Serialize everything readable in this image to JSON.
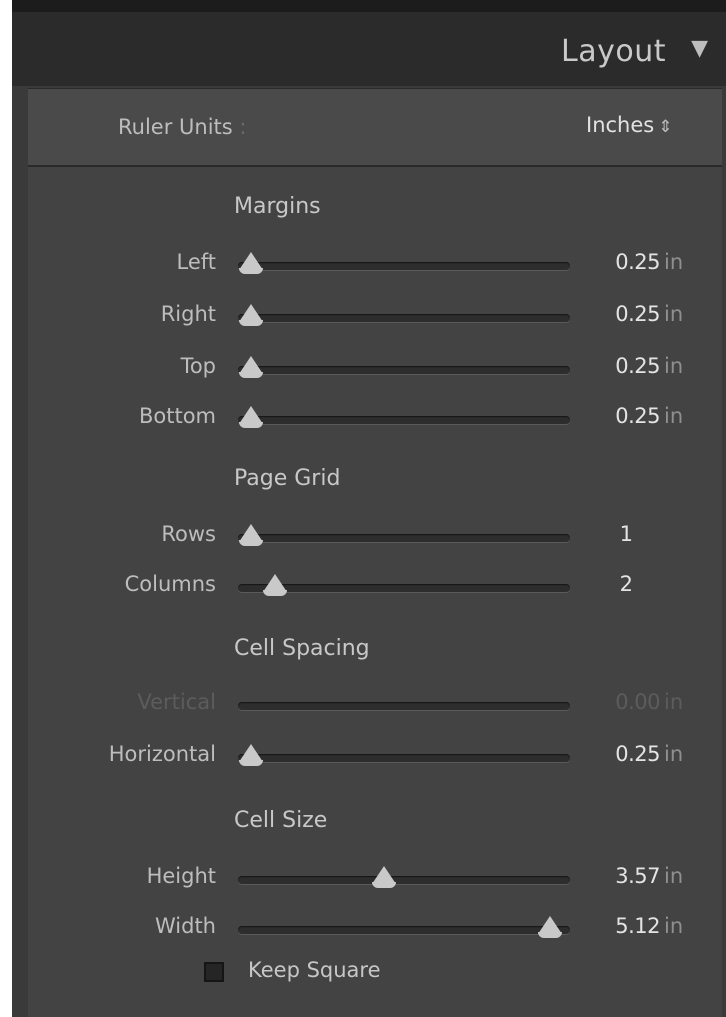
{
  "header": {
    "title": "Layout",
    "toggle_icon": "▼"
  },
  "ruler_units": {
    "label": "Ruler Units",
    "colon": ":",
    "value": "Inches",
    "arrow": "⇕"
  },
  "sections": {
    "margins": "Margins",
    "page_grid": "Page Grid",
    "cell_spacing": "Cell Spacing",
    "cell_size": "Cell Size"
  },
  "sliders": {
    "left": {
      "label": "Left",
      "value": "0.25",
      "unit": "in",
      "level": 0.04
    },
    "right": {
      "label": "Right",
      "value": "0.25",
      "unit": "in",
      "level": 0.04
    },
    "top": {
      "label": "Top",
      "value": "0.25",
      "unit": "in",
      "level": 0.04
    },
    "bottom": {
      "label": "Bottom",
      "value": "0.25",
      "unit": "in",
      "level": 0.04
    },
    "rows": {
      "label": "Rows",
      "value": "1",
      "level": 0.04
    },
    "columns": {
      "label": "Columns",
      "value": "2",
      "level": 0.11
    },
    "vertical": {
      "label": "Vertical",
      "value": "0.00",
      "unit": "in",
      "disabled": true
    },
    "horizontal": {
      "label": "Horizontal",
      "value": "0.25",
      "unit": "in",
      "level": 0.04
    },
    "height": {
      "label": "Height",
      "value": "3.57",
      "unit": "in",
      "level": 0.44
    },
    "width": {
      "label": "Width",
      "value": "5.12",
      "unit": "in",
      "level": 0.94
    }
  },
  "keep_square": {
    "label": "Keep Square",
    "checked": false
  }
}
